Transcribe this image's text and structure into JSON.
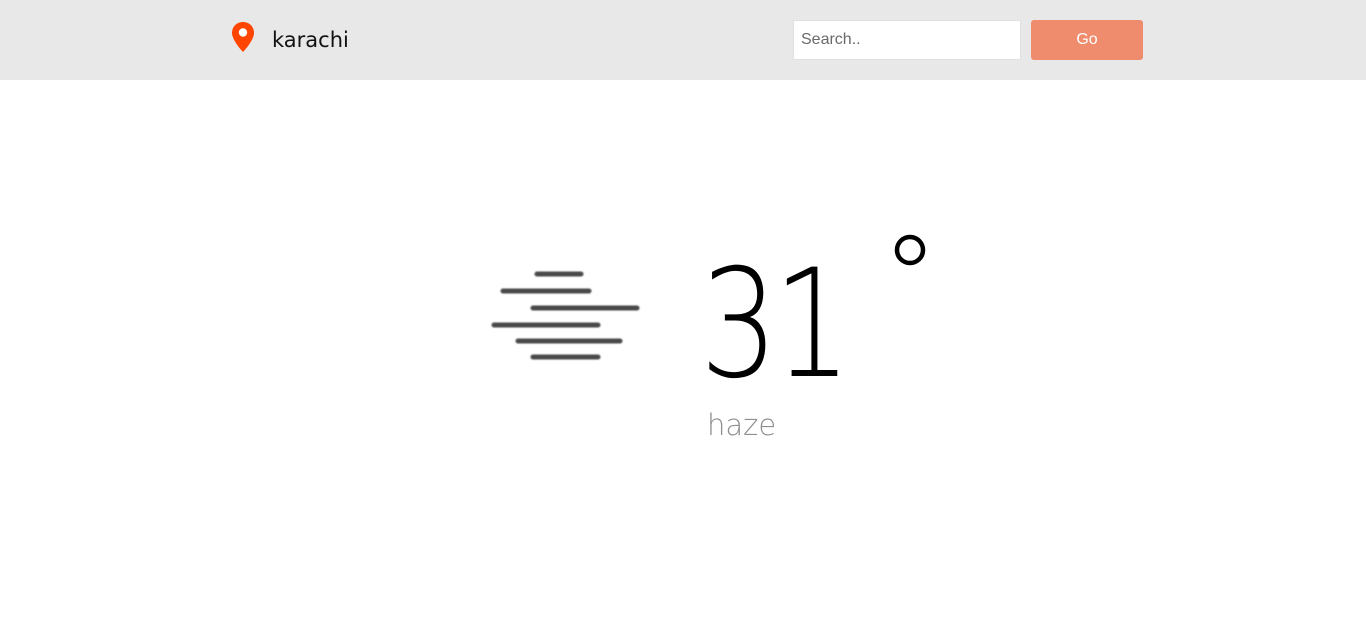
{
  "header": {
    "location": "karachi",
    "search": {
      "placeholder": "Search..",
      "value": ""
    },
    "go_label": "Go",
    "pin_icon": "map-pin-icon"
  },
  "weather": {
    "temperature": "31",
    "unit_symbol": "°",
    "condition": "haze",
    "icon": "haze-icon"
  },
  "colors": {
    "header_bg": "#e8e8e8",
    "accent": "#f08c6e",
    "pin": "#ff4500",
    "condition_text": "#8e8e8e"
  }
}
